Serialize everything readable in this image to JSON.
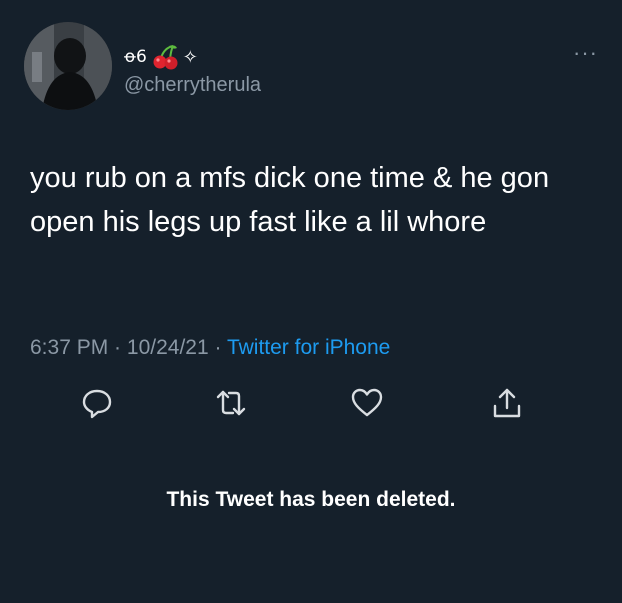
{
  "user": {
    "display_name": "ꝋ6",
    "handle": "@cherrytherula",
    "sparkle": "✧"
  },
  "more_icon": "more-icon",
  "tweet": {
    "text": "you rub on a mfs dick one time & he gon open his legs up fast like a lil whore",
    "time": "6:37 PM",
    "date": "10/24/21",
    "separator": " · ",
    "source": "Twitter for iPhone"
  },
  "actions": [
    "reply-icon",
    "retweet-icon",
    "like-icon",
    "share-icon"
  ],
  "notice": "This Tweet has been deleted.",
  "colors": {
    "background": "#15202b",
    "text": "#ffffff",
    "secondary": "#8b98a5",
    "link": "#1d9bf0"
  }
}
